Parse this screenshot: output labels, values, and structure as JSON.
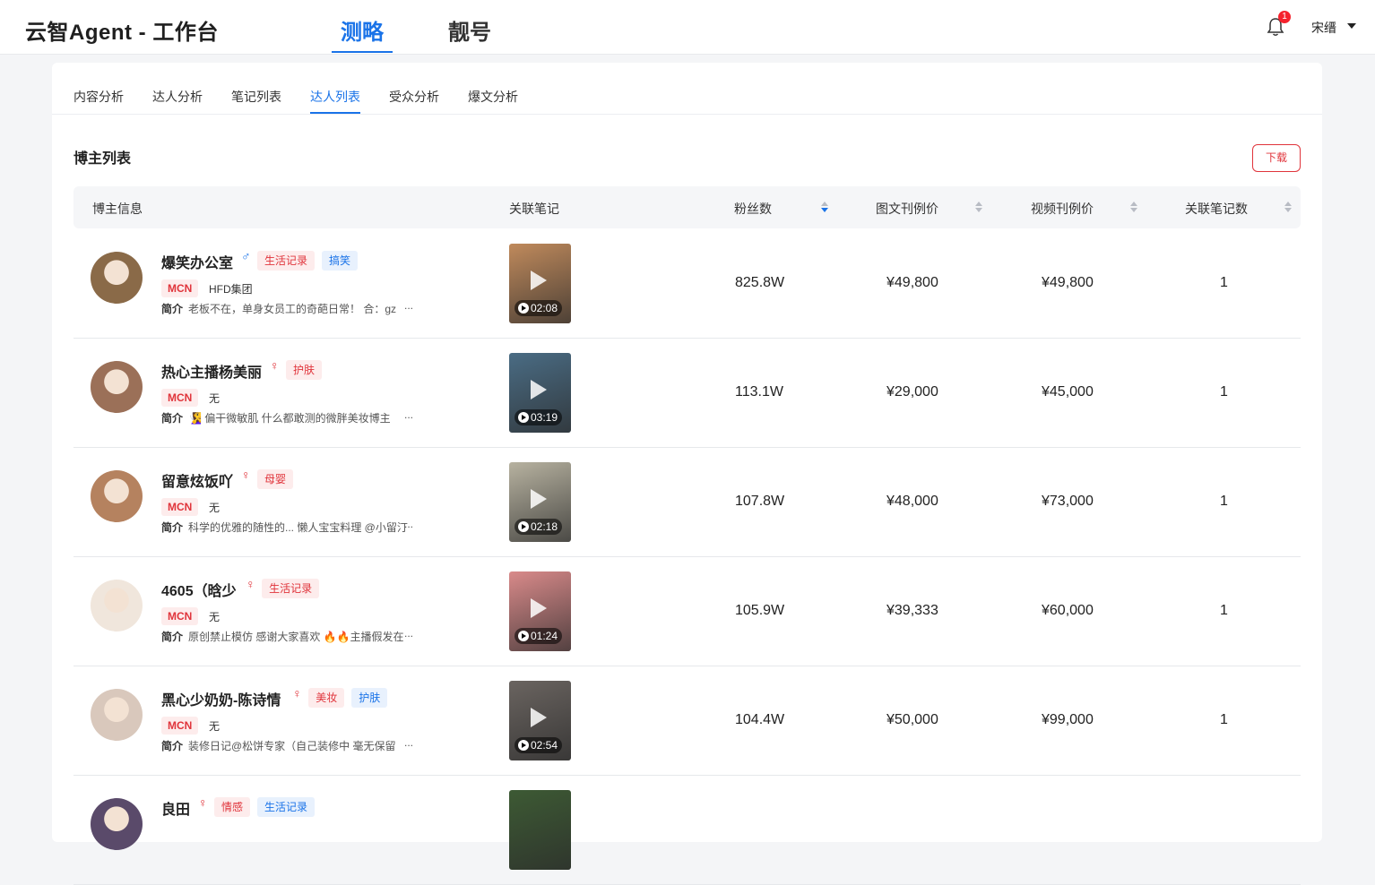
{
  "header": {
    "app_title": "云智Agent - 工作台",
    "tabs": [
      {
        "label": "测略",
        "active": true
      },
      {
        "label": "靓号",
        "active": false
      }
    ],
    "notification_count": "1",
    "user_name": "宋缙"
  },
  "sub_tabs": [
    {
      "label": "内容分析",
      "active": false
    },
    {
      "label": "达人分析",
      "active": false
    },
    {
      "label": "笔记列表",
      "active": false
    },
    {
      "label": "达人列表",
      "active": true
    },
    {
      "label": "受众分析",
      "active": false
    },
    {
      "label": "爆文分析",
      "active": false
    }
  ],
  "section": {
    "title": "博主列表",
    "download_label": "下载"
  },
  "table": {
    "columns": [
      {
        "label": "博主信息",
        "sortable": false
      },
      {
        "label": "关联笔记",
        "sortable": false
      },
      {
        "label": "粉丝数",
        "sortable": true,
        "sort": "desc"
      },
      {
        "label": "图文刊例价",
        "sortable": true,
        "sort": "none"
      },
      {
        "label": "视频刊例价",
        "sortable": true,
        "sort": "none"
      },
      {
        "label": "关联笔记数",
        "sortable": true,
        "sort": "none"
      }
    ],
    "mcn_label": "MCN",
    "bio_label": "简介",
    "ellipsis": "...",
    "rows": [
      {
        "name": "爆笑办公室",
        "gender": "♂",
        "gender_type": "male",
        "tags": [
          {
            "text": "生活记录",
            "color": "red"
          },
          {
            "text": "搞笑",
            "color": "blue"
          }
        ],
        "mcn": "HFD集团",
        "bio": "老板不在，单身女员工的奇葩日常！ 合：gz",
        "duration": "02:08",
        "fans": "825.8W",
        "image_price": "¥49,800",
        "video_price": "¥49,800",
        "notes": "1",
        "avatar_color": "#8a6a48",
        "thumb_color": "#c08a5c"
      },
      {
        "name": "热心主播杨美丽",
        "gender": "♀",
        "gender_type": "female",
        "tags": [
          {
            "text": "护肤",
            "color": "red"
          }
        ],
        "mcn": "无",
        "bio": "🧏‍♀️ 偏干微敏肌 什么都敢测的微胖美妆博主",
        "duration": "03:19",
        "fans": "113.1W",
        "image_price": "¥29,000",
        "video_price": "¥45,000",
        "notes": "1",
        "avatar_color": "#9b7058",
        "thumb_color": "#4a6c84"
      },
      {
        "name": "留意炫饭吖",
        "gender": "♀",
        "gender_type": "female",
        "tags": [
          {
            "text": "母婴",
            "color": "red"
          }
        ],
        "mcn": "无",
        "bio": "科学的优雅的随性的... 懒人宝宝料理 @小留汀",
        "duration": "02:18",
        "fans": "107.8W",
        "image_price": "¥48,000",
        "video_price": "¥73,000",
        "notes": "1",
        "avatar_color": "#b5825f",
        "thumb_color": "#b7b2a0"
      },
      {
        "name": "4605（晗少",
        "gender": "♀",
        "gender_type": "female",
        "tags": [
          {
            "text": "生活记录",
            "color": "red"
          }
        ],
        "mcn": "无",
        "bio": "原创禁止模仿 感谢大家喜欢 🔥🔥主播假发在",
        "duration": "01:24",
        "fans": "105.9W",
        "image_price": "¥39,333",
        "video_price": "¥60,000",
        "notes": "1",
        "avatar_color": "#f0e6dc",
        "thumb_color": "#d98a8a"
      },
      {
        "name": "黑心少奶奶-陈诗情",
        "gender": "♀",
        "gender_type": "female",
        "tags": [
          {
            "text": "美妆",
            "color": "red"
          },
          {
            "text": "护肤",
            "color": "blue"
          }
        ],
        "mcn": "无",
        "bio": "装修日记@松饼专家（自己装修中 毫无保留",
        "duration": "02:54",
        "fans": "104.4W",
        "image_price": "¥50,000",
        "video_price": "¥99,000",
        "notes": "1",
        "avatar_color": "#d9c8bc",
        "thumb_color": "#6a6460"
      },
      {
        "name": "良田",
        "gender": "♀",
        "gender_type": "female",
        "tags": [
          {
            "text": "情感",
            "color": "red"
          },
          {
            "text": "生活记录",
            "color": "blue"
          }
        ],
        "mcn": "",
        "bio": "",
        "duration": "",
        "fans": "",
        "image_price": "",
        "video_price": "",
        "notes": "",
        "avatar_color": "#5a4a6a",
        "thumb_color": "#3d5a34"
      }
    ]
  }
}
